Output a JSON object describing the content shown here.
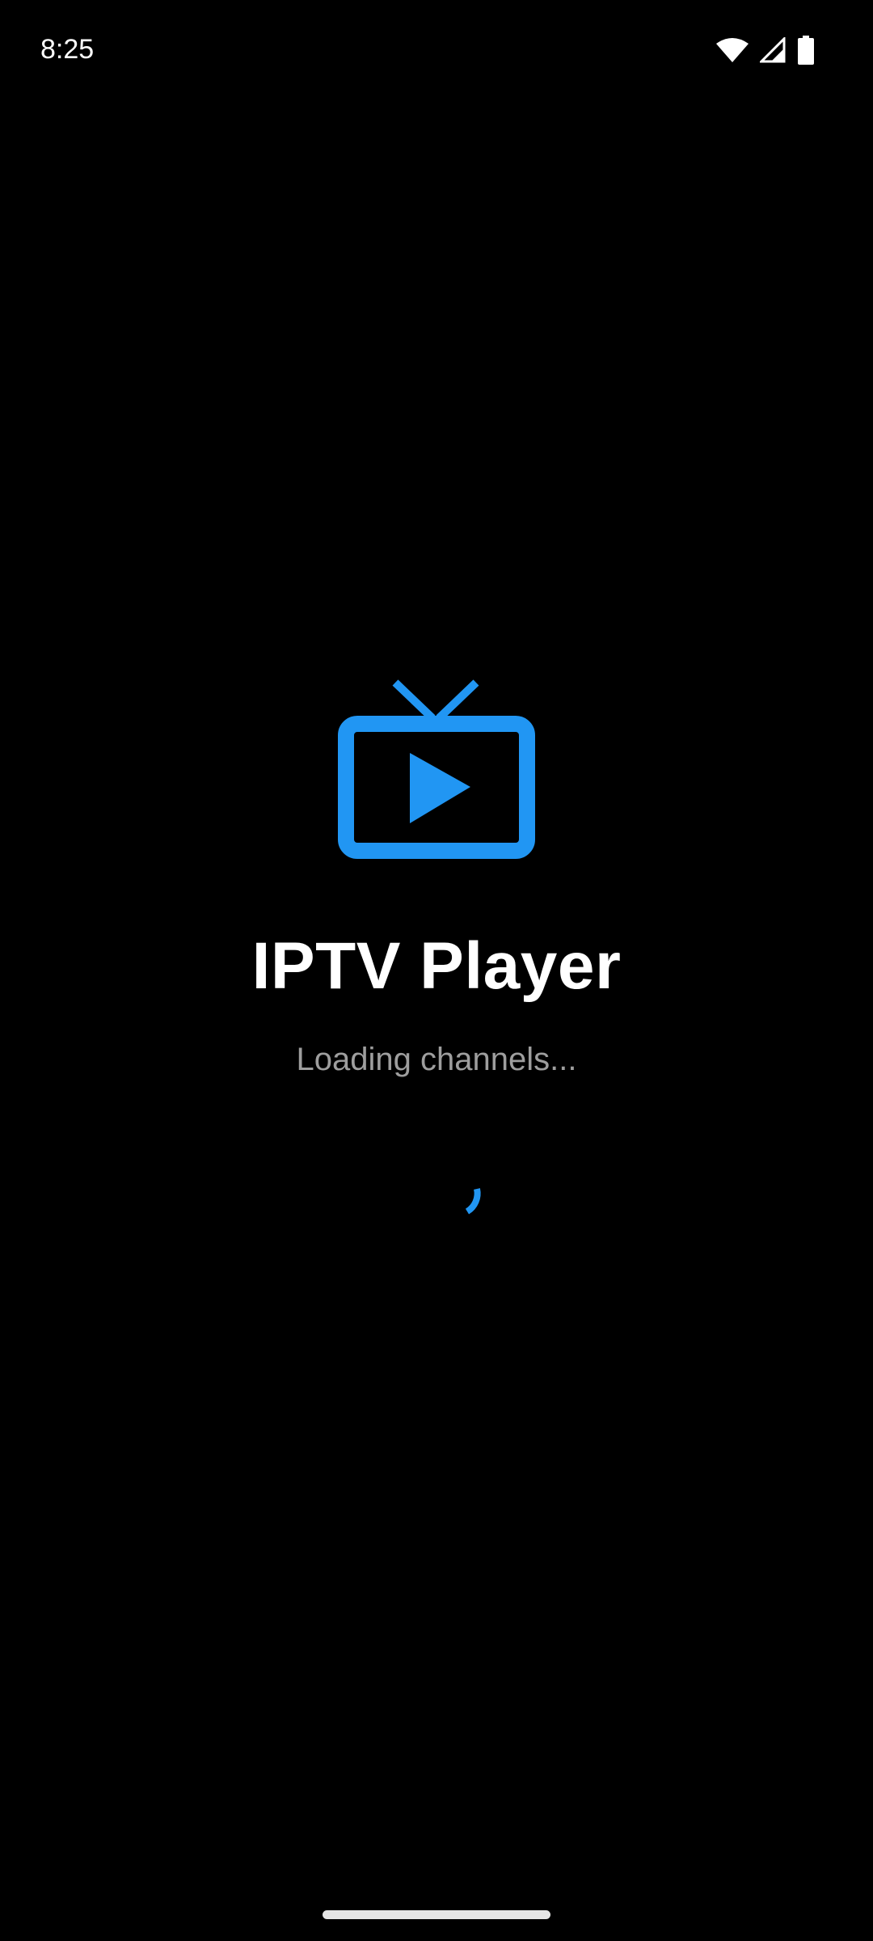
{
  "status_bar": {
    "time": "8:25",
    "icons": [
      "wifi-icon",
      "cell-signal-icon",
      "battery-icon"
    ]
  },
  "splash": {
    "logo_icon": "tv-play-icon",
    "title": "IPTV Player",
    "subtitle": "Loading channels...",
    "spinner_icon": "loading-spinner-icon"
  },
  "colors": {
    "background": "#000000",
    "accent": "#2196F3",
    "title": "#FFFFFF",
    "subtitle": "#9E9E9E"
  }
}
